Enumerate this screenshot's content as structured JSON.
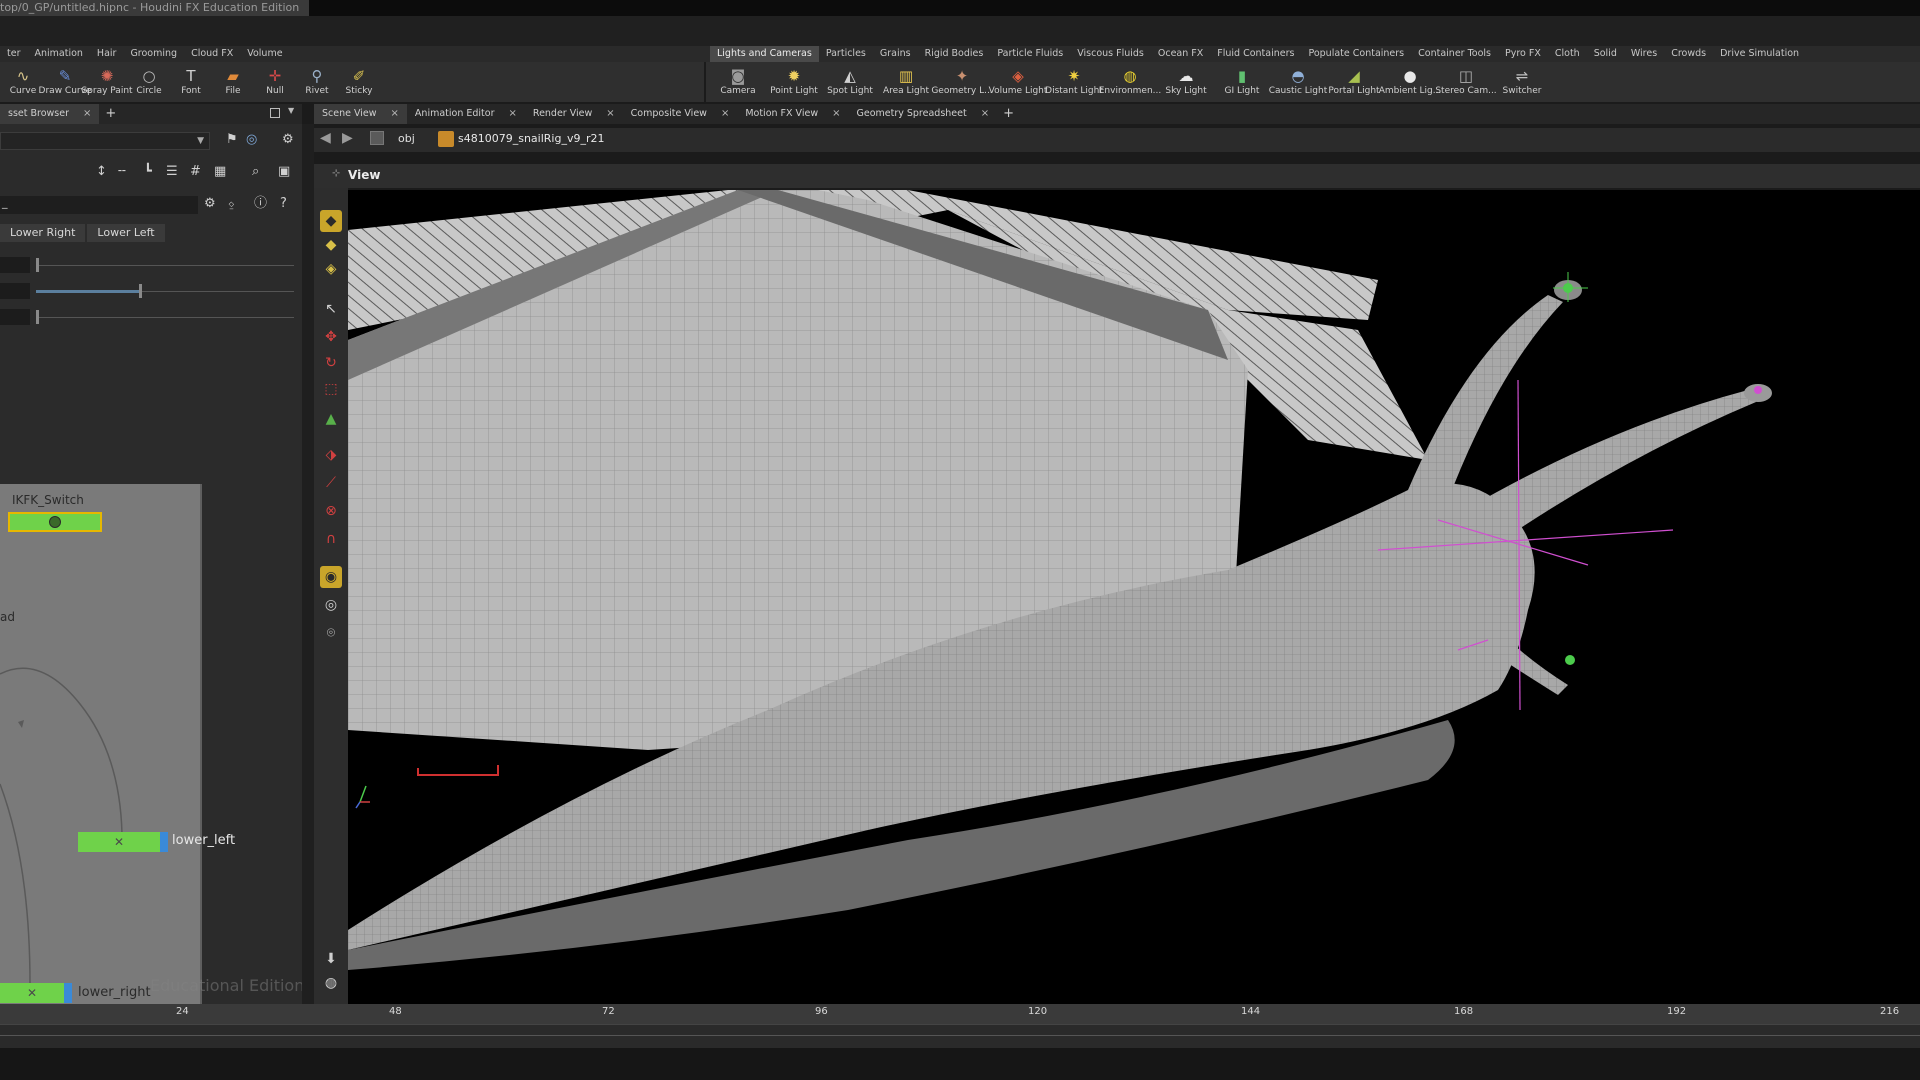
{
  "window": {
    "title": "top/0_GP/untitled.hipnc - Houdini FX Education Edition"
  },
  "shelf_left": {
    "tabs": [
      "ter",
      "Animation",
      "Hair",
      "Grooming",
      "Cloud FX",
      "Volume"
    ],
    "tools": [
      {
        "label": "Curve",
        "icon": "curve-icon",
        "color": "#d8c58a"
      },
      {
        "label": "Draw Curve",
        "icon": "draw-curve-icon",
        "color": "#6a8ed8"
      },
      {
        "label": "Spray Paint",
        "icon": "spray-paint-icon",
        "color": "#d86a5a"
      },
      {
        "label": "Circle",
        "icon": "circle-icon",
        "color": "#bdbdbd"
      },
      {
        "label": "Font",
        "icon": "font-icon",
        "color": "#d0d0d0"
      },
      {
        "label": "File",
        "icon": "file-icon",
        "color": "#e08a3a"
      },
      {
        "label": "Null",
        "icon": "null-icon",
        "color": "#d84a4a"
      },
      {
        "label": "Rivet",
        "icon": "rivet-icon",
        "color": "#9ab0c8"
      },
      {
        "label": "Sticky",
        "icon": "sticky-icon",
        "color": "#d8c050"
      }
    ]
  },
  "shelf_right": {
    "tabs": [
      "Lights and Cameras",
      "Particles",
      "Grains",
      "Rigid Bodies",
      "Particle Fluids",
      "Viscous Fluids",
      "Ocean FX",
      "Fluid Containers",
      "Populate Containers",
      "Container Tools",
      "Pyro FX",
      "Cloth",
      "Solid",
      "Wires",
      "Crowds",
      "Drive Simulation"
    ],
    "tools": [
      {
        "label": "Camera",
        "icon": "camera-icon",
        "color": "#9a9a9a"
      },
      {
        "label": "Point Light",
        "icon": "point-light-icon",
        "color": "#f0d060"
      },
      {
        "label": "Spot Light",
        "icon": "spot-light-icon",
        "color": "#d0d0d0"
      },
      {
        "label": "Area Light",
        "icon": "area-light-icon",
        "color": "#e8c850"
      },
      {
        "label": "Geometry L...",
        "icon": "geometry-light-icon",
        "color": "#c89070"
      },
      {
        "label": "Volume Light",
        "icon": "volume-light-icon",
        "color": "#e06040"
      },
      {
        "label": "Distant Light",
        "icon": "distant-light-icon",
        "color": "#f0d040"
      },
      {
        "label": "Environmen...",
        "icon": "environment-light-icon",
        "color": "#e8d030"
      },
      {
        "label": "Sky Light",
        "icon": "sky-light-icon",
        "color": "#e8e8e8"
      },
      {
        "label": "GI Light",
        "icon": "gi-light-icon",
        "color": "#60c070"
      },
      {
        "label": "Caustic Light",
        "icon": "caustic-light-icon",
        "color": "#90b0d8"
      },
      {
        "label": "Portal Light",
        "icon": "portal-light-icon",
        "color": "#a8c050"
      },
      {
        "label": "Ambient Lig...",
        "icon": "ambient-light-icon",
        "color": "#e8e8e8"
      },
      {
        "label": "Stereo Cam...",
        "icon": "stereo-camera-icon",
        "color": "#b0b0b0"
      },
      {
        "label": "Switcher",
        "icon": "switcher-icon",
        "color": "#c0c0c0"
      }
    ]
  },
  "left_panes": {
    "tab": "sset Browser"
  },
  "view_panes": {
    "tabs": [
      "Scene View",
      "Animation Editor",
      "Render View",
      "Composite View",
      "Motion FX View",
      "Geometry Spreadsheet"
    ]
  },
  "path": {
    "root": "obj",
    "node": "s4810079_snailRig_v9_r21"
  },
  "viewport": {
    "label": "View"
  },
  "params": {
    "field": "_",
    "tabs": [
      "Lower Right",
      "Lower Left"
    ],
    "sliders": [
      0.0,
      0.4,
      0.0
    ]
  },
  "network": {
    "nodes": [
      {
        "name": "IKFK_Switch"
      },
      {
        "name": "lower_left"
      },
      {
        "name": "lower_right"
      }
    ],
    "partial_label": "ad",
    "watermark": "Educational Edition"
  },
  "timeline": {
    "ticks": [
      "24",
      "48",
      "72",
      "96",
      "120",
      "144",
      "168",
      "192",
      "216"
    ]
  },
  "colors": {
    "accent": "#5b7f9e",
    "node_green": "#6fd24a",
    "node_selected": "#e6b800",
    "handle_magenta": "#d04fd0"
  }
}
